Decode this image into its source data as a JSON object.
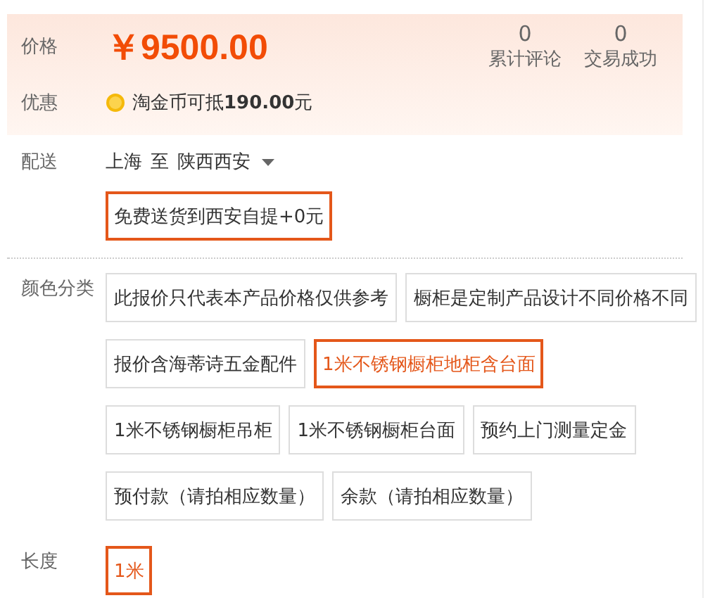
{
  "price": {
    "label": "价格",
    "amount": "￥9500.00"
  },
  "stats": [
    {
      "value": "0",
      "label": "累计评论"
    },
    {
      "value": "0",
      "label": "交易成功"
    }
  ],
  "promo": {
    "label": "优惠",
    "text": "淘金币可抵**190.00**元"
  },
  "delivery": {
    "label": "配送",
    "from": "上海",
    "to_word": "至",
    "to": "陕西西安",
    "options": [
      {
        "label": "免费送货到西安自提+0元",
        "selected": true
      }
    ]
  },
  "specs": [
    {
      "label": "颜色分类",
      "options": [
        {
          "label": "此报价只代表本产品价格仅供参考",
          "selected": false
        },
        {
          "label": "橱柜是定制产品设计不同价格不同",
          "selected": false
        },
        {
          "label": "报价含海蒂诗五金配件",
          "selected": false
        },
        {
          "label": "1米不锈钢橱柜地柜含台面",
          "selected": true
        },
        {
          "label": "1米不锈钢橱柜吊柜",
          "selected": false
        },
        {
          "label": "1米不锈钢橱柜台面",
          "selected": false
        },
        {
          "label": "预约上门测量定金",
          "selected": false
        },
        {
          "label": "预付款（请拍相应数量）",
          "selected": false
        },
        {
          "label": "余款（请拍相应数量）",
          "selected": false
        }
      ]
    },
    {
      "label": "长度",
      "options": [
        {
          "label": "1米",
          "selected": true
        }
      ]
    }
  ]
}
